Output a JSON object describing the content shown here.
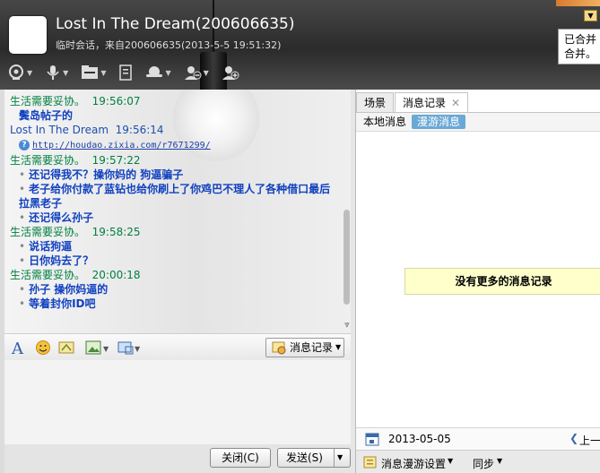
{
  "window": {
    "title": "Lost In The Dream(200606635)",
    "subtitle": "临时会话，来自200606635(2013-5-5 19:51:32)"
  },
  "toolbar": {
    "icons": [
      "video-call-icon",
      "voice-call-icon",
      "file-transfer-icon",
      "remote-desktop-icon",
      "share-screen-icon",
      "remove-contact-icon",
      "add-friend-icon"
    ]
  },
  "messages": [
    {
      "sender": "生活需要妥协。",
      "time": "19:56:07",
      "lines": [
        {
          "bullet": false,
          "text": "鬓岛帖子的"
        }
      ]
    },
    {
      "sender": "Lost In The Dream",
      "time": "19:56:14",
      "link": "http://houdao.zixia.com/r7671299/",
      "lines": []
    },
    {
      "sender": "生活需要妥协。",
      "time": "19:57:22",
      "lines": [
        {
          "bullet": true,
          "text": "还记得我不？操你妈的 狗逼骗子"
        },
        {
          "bullet": true,
          "text": "老子给你付款了蓝钻也给你刷上了你鸡巴不理人了各种借口最后拉黑老子"
        },
        {
          "bullet": true,
          "text": "还记得么孙子"
        }
      ]
    },
    {
      "sender": "生活需要妥协。",
      "time": "19:58:25",
      "lines": [
        {
          "bullet": true,
          "text": "说话狗逼"
        },
        {
          "bullet": true,
          "text": "日你妈去了？"
        }
      ]
    },
    {
      "sender": "生活需要妥协。",
      "time": "20:00:18",
      "lines": [
        {
          "bullet": true,
          "text": "孙子 操你妈逼的"
        },
        {
          "bullet": true,
          "text": "等着封你ID吧"
        }
      ]
    }
  ],
  "format_bar": {
    "message_record_label": "消息记录"
  },
  "buttons": {
    "close_label": "关闭(C)",
    "send_label": "发送(S)"
  },
  "right_panel": {
    "tabs": [
      "场景",
      "消息记录"
    ],
    "subtabs": [
      "本地消息",
      "漫游消息"
    ],
    "no_more": "没有更多的消息记录",
    "date": "2013-05-05",
    "prev_label": "上一",
    "roam_settings_label": "消息漫游设置",
    "sync_label": "同步"
  },
  "notice": {
    "line1": "已合并",
    "line2": "合并。"
  }
}
